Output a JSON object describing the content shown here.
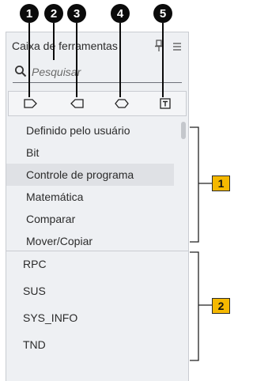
{
  "callouts": [
    "1",
    "2",
    "3",
    "4",
    "5"
  ],
  "panel": {
    "title": "Caixa de ferramentas",
    "search_placeholder": "Pesquisar"
  },
  "filters": [
    "contact-filter-icon",
    "coil-filter-icon",
    "box-filter-icon",
    "text-filter-icon"
  ],
  "categories": [
    "Definido pelo usuário",
    "Bit",
    "Controle de programa",
    "Matemática",
    "Comparar",
    "Mover/Copiar"
  ],
  "selected_category": "Controle de programa",
  "instructions": [
    "RPC",
    "SUS",
    "SYS_INFO",
    "TND"
  ],
  "annotations": {
    "categories_badge": "1",
    "instructions_badge": "2"
  },
  "colors": {
    "panel": "#eef0f3",
    "selected": "#dfe1e5",
    "badge": "#f5b800",
    "callout": "#0b0b0b"
  }
}
